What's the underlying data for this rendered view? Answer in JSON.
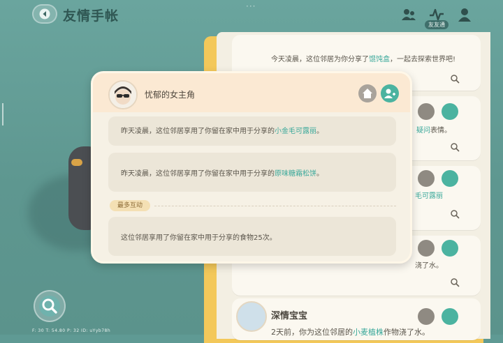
{
  "header": {
    "title": "友情手帐",
    "more_dots": "···",
    "active_tab_label": "友友通"
  },
  "popup": {
    "name": "忧郁的女主角",
    "entries": [
      {
        "prefix": "昨天凌晨，这位邻居享用了你留在家中用于分享的",
        "item": "小金毛可露丽",
        "suffix": "。"
      },
      {
        "prefix": "昨天凌晨，这位邻居享用了你留在家中用于分享的",
        "item": "原味糖霜松饼",
        "suffix": "。"
      }
    ],
    "section_label": "最多互动",
    "summary": "这位邻居享用了你留在家中用于分享的食物25次。"
  },
  "notebook": {
    "card1_prefix": "今天凌晨，这位邻居为你分享了",
    "card1_item": "馄饨盒",
    "card1_suffix": "，一起去探索世界吧!",
    "card2_tail_item": "疑问",
    "card2_tail_suffix": "表情。",
    "card3_tail": "毛可露丽",
    "card4_tail": "浇了水。",
    "card5_name": "深情宝宝",
    "card5_prefix": "2天前，你为这位邻居的",
    "card5_item": "小麦植株",
    "card5_suffix": "作物浇了水。"
  },
  "debug": "F: 30    T: 54.80    P: 32    ID: uYyb78h",
  "colors": {
    "accent": "#4bb3a0",
    "highlight": "#3aa89a",
    "notebook_frame": "#f3c85a"
  }
}
